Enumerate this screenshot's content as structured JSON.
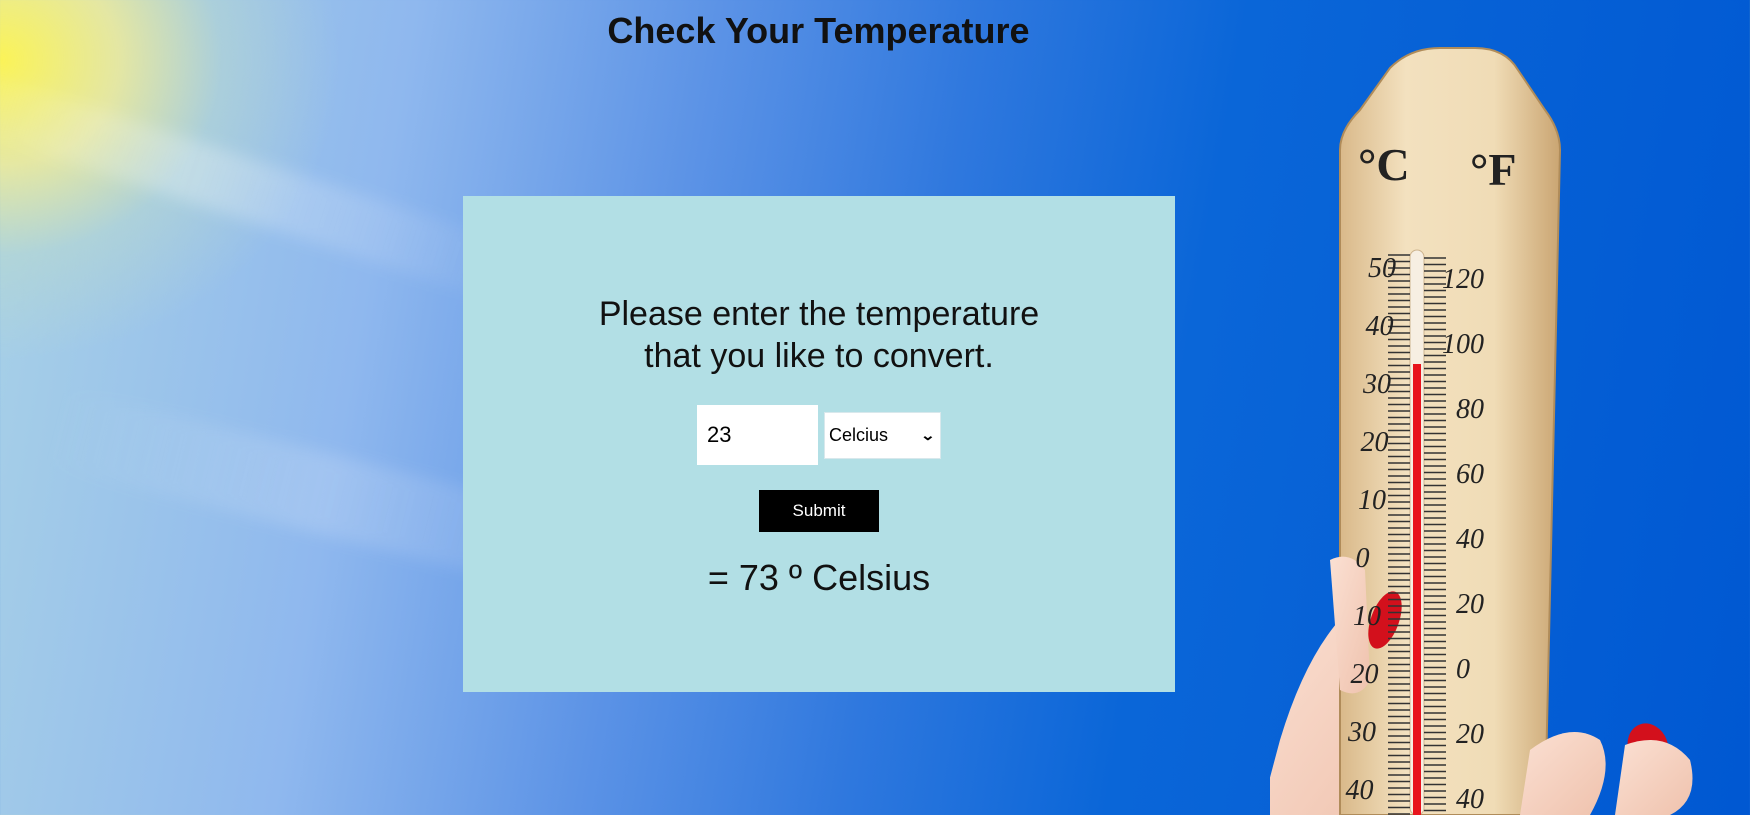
{
  "page": {
    "title": "Check Your Temperature"
  },
  "converter": {
    "prompt_line1": "Please enter the temperature",
    "prompt_line2": "that you like to convert.",
    "input_value": "23",
    "unit_selected": "Celcius",
    "submit_label": "Submit",
    "result": "= 73 º Celsius"
  },
  "thermometer": {
    "celsius_label": "°C",
    "fahrenheit_label": "°F",
    "celsius_ticks": [
      "50",
      "40",
      "30",
      "20",
      "10",
      "0",
      "10",
      "20",
      "30",
      "40"
    ],
    "fahrenheit_ticks": [
      "120",
      "100",
      "80",
      "60",
      "40",
      "20",
      "0",
      "20",
      "40"
    ]
  },
  "colors": {
    "card_bg": "#b2dfe5",
    "button_bg": "#000000",
    "mercury": "#e8141c"
  }
}
